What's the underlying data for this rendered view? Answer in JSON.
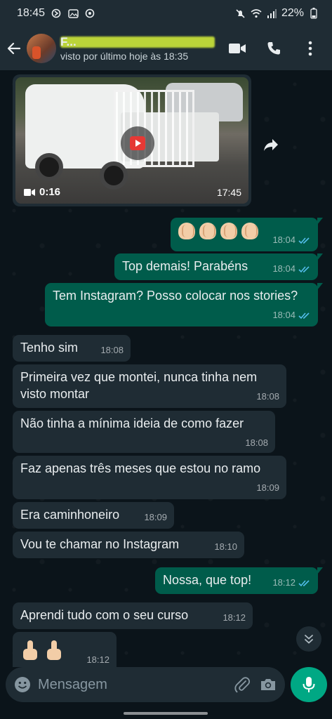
{
  "status_bar": {
    "time": "18:45",
    "battery": "22%"
  },
  "header": {
    "contact_name": "F...",
    "contact_status": "visto por último hoje às 18:35"
  },
  "video_message": {
    "duration": "0:16",
    "time": "17:45"
  },
  "messages": [
    {
      "direction": "out",
      "type": "emoji",
      "emoji": [
        "👏🏻",
        "👏🏻",
        "👏🏻",
        "👏🏻"
      ],
      "time": "18:04"
    },
    {
      "direction": "out",
      "text": "Top demais! Parabéns",
      "time": "18:04"
    },
    {
      "direction": "out",
      "text": "Tem Instagram? Posso colocar nos stories?",
      "time": "18:04"
    },
    {
      "direction": "in",
      "text": "Tenho sim",
      "time": "18:08"
    },
    {
      "direction": "in",
      "text": "Primeira vez que montei, nunca tinha nem visto montar",
      "time": "18:08"
    },
    {
      "direction": "in",
      "text": "Não tinha a mínima ideia de como fazer",
      "time": "18:08"
    },
    {
      "direction": "in",
      "text": "Faz apenas três meses que estou no ramo",
      "time": "18:09"
    },
    {
      "direction": "in",
      "text": "Era caminhoneiro",
      "time": "18:09"
    },
    {
      "direction": "in",
      "text": "Vou te chamar no Instagram",
      "time": "18:10"
    },
    {
      "direction": "out",
      "text": "Nossa, que top!",
      "time": "18:12"
    },
    {
      "direction": "in",
      "text": "Aprendi tudo com o seu curso",
      "time": "18:12"
    },
    {
      "direction": "in",
      "type": "emoji",
      "emoji": [
        "👍🏻",
        "👍🏻"
      ],
      "time": "18:12"
    }
  ],
  "input": {
    "placeholder": "Mensagem"
  },
  "colors": {
    "accent": "#00a884",
    "outgoing_bubble": "#005c4b",
    "incoming_bubble": "#1f2c34",
    "read_ticks": "#53bdeb",
    "background": "#0b141a"
  },
  "icons": [
    "back-arrow-icon",
    "video-call-icon",
    "phone-icon",
    "more-vert-icon",
    "play-icon",
    "video-camera-icon",
    "forward-icon",
    "double-check-icon",
    "chevron-down-icon",
    "emoji-icon",
    "attach-icon",
    "camera-icon",
    "mic-icon"
  ]
}
